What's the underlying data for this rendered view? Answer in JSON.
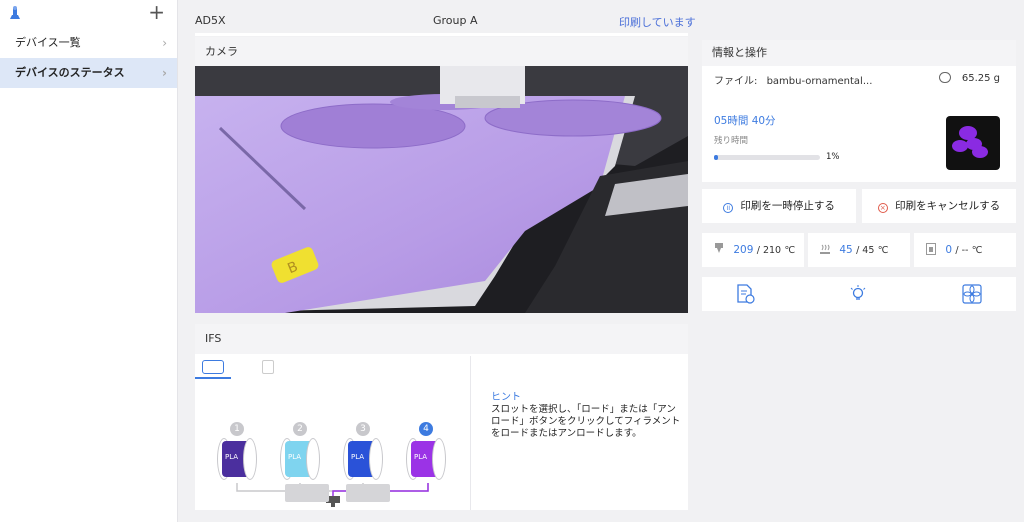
{
  "sidebar": {
    "items": [
      {
        "label": "デバイス一覧"
      },
      {
        "label": "デバイスのステータス"
      }
    ]
  },
  "header": {
    "device_name": "AD5X",
    "group": "Group A",
    "status": "印刷しています"
  },
  "camera": {
    "title": "カメラ"
  },
  "ifs": {
    "title": "IFS",
    "slots": [
      {
        "num": "1",
        "material": "PLA",
        "color": "#4b2f9e",
        "selected": false
      },
      {
        "num": "2",
        "material": "PLA",
        "color": "#7fd4ef",
        "selected": false
      },
      {
        "num": "3",
        "material": "PLA",
        "color": "#2a52d8",
        "selected": false
      },
      {
        "num": "4",
        "material": "PLA",
        "color": "#9b33e6",
        "selected": true
      }
    ],
    "hint_title": "ヒント",
    "hint_text": "スロットを選択し、「ロード」または「アンロード」ボタンをクリックしてフィラメントをロードまたはアンロードします。"
  },
  "info": {
    "title": "情報と操作",
    "file_label": "ファイル:",
    "file_name": "bambu-ornamental...",
    "weight": "65.25 g",
    "time": "05時間 40分",
    "remaining_label": "残り時間",
    "progress": 0.01,
    "progress_text": "1%"
  },
  "actions": {
    "pause": "印刷を一時停止する",
    "cancel": "印刷をキャンセルする"
  },
  "temps": [
    {
      "current": "209",
      "target": "/ 210",
      "unit": "℃"
    },
    {
      "current": "45",
      "target": "/ 45",
      "unit": "℃"
    },
    {
      "current": "0",
      "target": "/ --",
      "unit": "℃"
    }
  ],
  "colors": {
    "accent": "#3d7be0",
    "sidebar_active": "#dde7f7"
  },
  "icons": [
    "logo-icon",
    "plus-icon",
    "chevron-right-icon",
    "weight-icon",
    "pause-icon",
    "cancel-icon",
    "nozzle-icon",
    "bed-icon",
    "chamber-icon",
    "file-info-icon",
    "light-icon",
    "fan-icon"
  ]
}
